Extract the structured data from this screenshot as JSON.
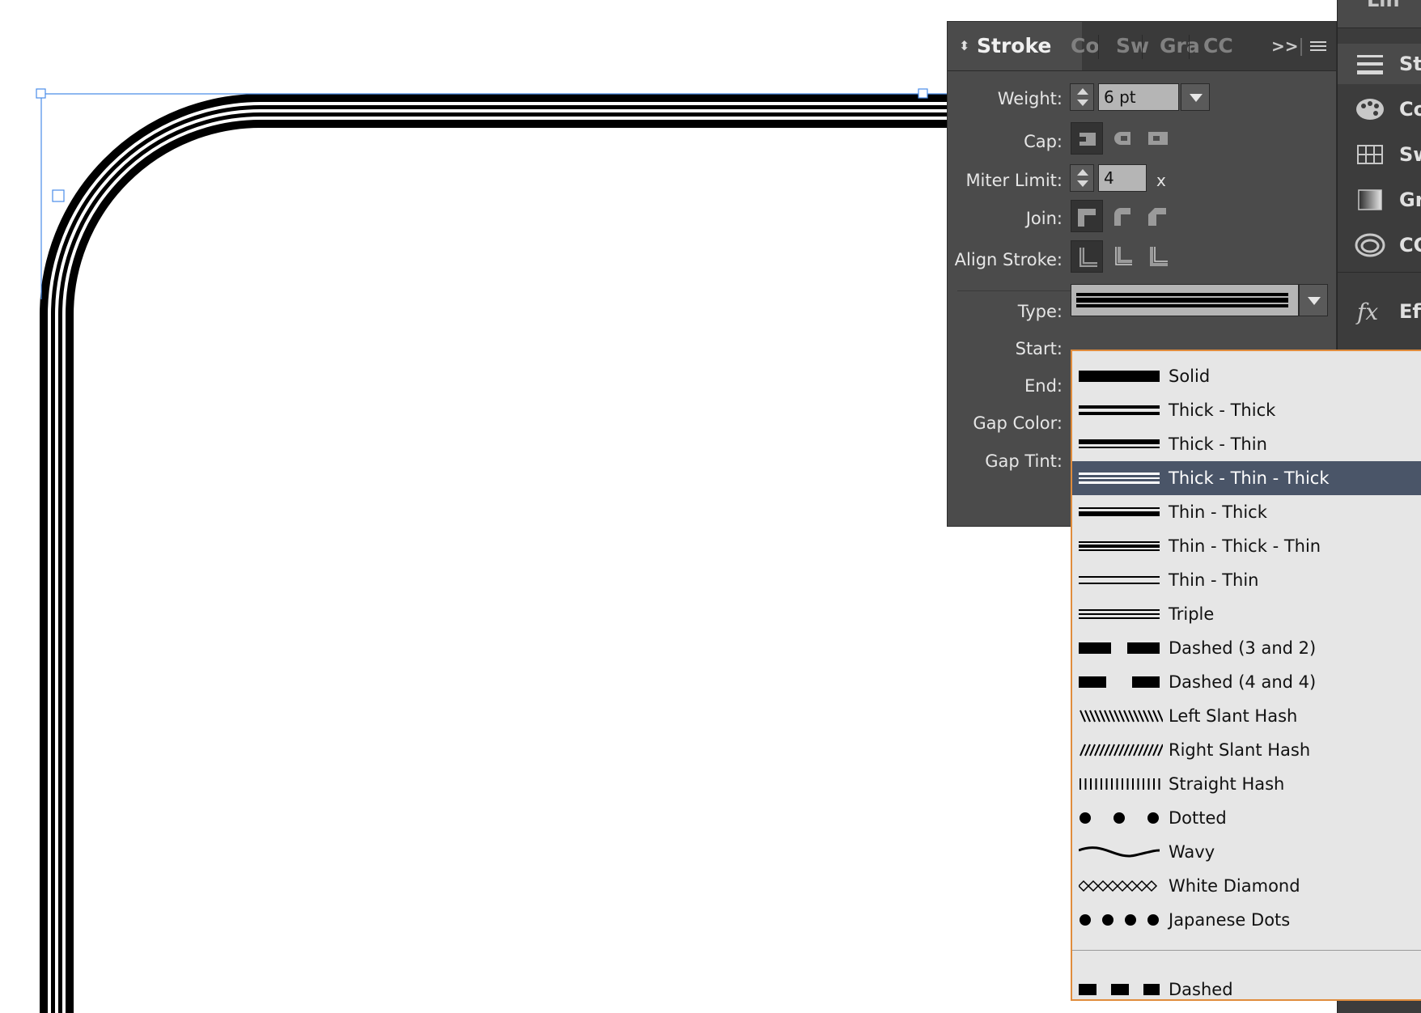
{
  "panel": {
    "tabs": [
      {
        "label": "Stroke",
        "active": true
      },
      {
        "label": "Co"
      },
      {
        "label": "Sw"
      },
      {
        "label": "Gra"
      },
      {
        "label": "CC"
      }
    ],
    "overflow_glyph": ">>",
    "weight": {
      "label": "Weight:",
      "value": "6 pt"
    },
    "cap": {
      "label": "Cap:"
    },
    "miter": {
      "label": "Miter Limit:",
      "value": "4",
      "suffix": "x"
    },
    "join": {
      "label": "Join:"
    },
    "align": {
      "label": "Align Stroke:"
    },
    "type": {
      "label": "Type:"
    },
    "start": {
      "label": "Start:"
    },
    "end": {
      "label": "End:"
    },
    "gap_color": {
      "label": "Gap Color:"
    },
    "gap_tint": {
      "label": "Gap Tint:"
    }
  },
  "dock": {
    "top_label": "Lin",
    "items": [
      {
        "label": "Str",
        "icon": "stroke-lines-icon"
      },
      {
        "label": "Co",
        "icon": "color-palette-icon"
      },
      {
        "label": "Sw",
        "icon": "swatches-grid-icon"
      },
      {
        "label": "Gr",
        "icon": "gradient-icon"
      },
      {
        "label": "CC",
        "icon": "creative-cloud-icon"
      },
      {
        "label": "Eff",
        "icon": "fx-icon"
      }
    ]
  },
  "type_menu": {
    "highlight_color": "#4a5568",
    "border_color": "#e08c3c",
    "items": [
      {
        "label": "Solid",
        "style": "solid"
      },
      {
        "label": "Thick - Thick",
        "style": "thick-thick"
      },
      {
        "label": "Thick - Thin",
        "style": "thick-thin"
      },
      {
        "label": "Thick - Thin - Thick",
        "style": "thick-thin-thick",
        "selected": true
      },
      {
        "label": "Thin - Thick",
        "style": "thin-thick"
      },
      {
        "label": "Thin - Thick - Thin",
        "style": "thin-thick-thin"
      },
      {
        "label": "Thin - Thin",
        "style": "thin-thin"
      },
      {
        "label": "Triple",
        "style": "triple"
      },
      {
        "label": "Dashed (3 and 2)",
        "style": "dashed-3-2"
      },
      {
        "label": "Dashed (4 and 4)",
        "style": "dashed-4-4"
      },
      {
        "label": "Left Slant Hash",
        "style": "left-slant-hash"
      },
      {
        "label": "Right Slant Hash",
        "style": "right-slant-hash"
      },
      {
        "label": "Straight Hash",
        "style": "straight-hash"
      },
      {
        "label": "Dotted",
        "style": "dotted"
      },
      {
        "label": "Wavy",
        "style": "wavy"
      },
      {
        "label": "White Diamond",
        "style": "white-diamond"
      },
      {
        "label": "Japanese Dots",
        "style": "japanese-dots"
      }
    ],
    "custom_items": [
      {
        "label": "Dashed",
        "style": "dashed-custom"
      }
    ]
  }
}
